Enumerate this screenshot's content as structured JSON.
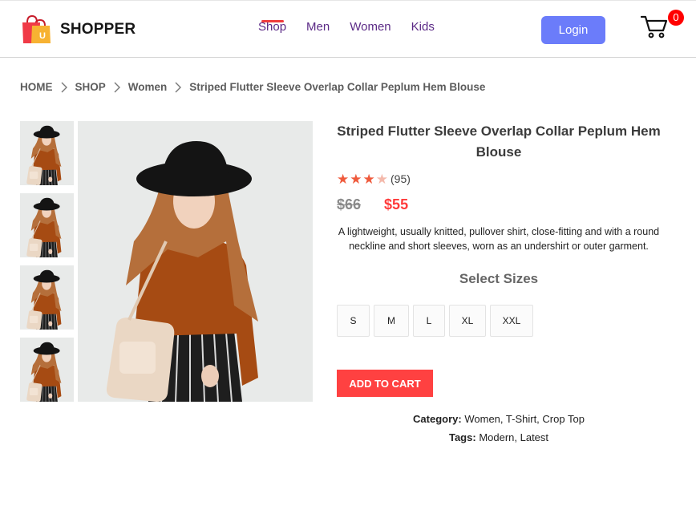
{
  "brand": {
    "name": "SHOPPER",
    "logo_letter": "U"
  },
  "nav": {
    "links": [
      {
        "label": "Shop",
        "active": true
      },
      {
        "label": "Men",
        "active": false
      },
      {
        "label": "Women",
        "active": false
      },
      {
        "label": "Kids",
        "active": false
      }
    ],
    "login_label": "Login",
    "cart_count": "0"
  },
  "breadcrumb": [
    "HOME",
    "SHOP",
    "Women",
    "Striped Flutter Sleeve Overlap Collar Peplum Hem Blouse"
  ],
  "product": {
    "title": "Striped Flutter Sleeve Overlap Collar Peplum Hem Blouse",
    "rating": 3,
    "rating_max": 4,
    "review_count": "(95)",
    "old_price": "$66",
    "new_price": "$55",
    "description": "A lightweight, usually knitted, pullover shirt, close-fitting and with a round neckline and short sleeves, worn as an undershirt or outer garment.",
    "sizes_title": "Select Sizes",
    "sizes": [
      "S",
      "M",
      "L",
      "XL",
      "XXL"
    ],
    "add_to_cart": "ADD TO CART",
    "category_label": "Category:",
    "category_value": "Women, T-Shirt, Crop Top",
    "tags_label": "Tags:",
    "tags_value": "Modern, Latest",
    "thumbnail_count": 4
  },
  "colors": {
    "accent": "#ff4141",
    "login": "#6b7cfa",
    "nav": "#5b2a86"
  },
  "icons": [
    "shopping-bag-logo-icon",
    "cart-icon",
    "chevron-right-icon",
    "star-icon"
  ]
}
